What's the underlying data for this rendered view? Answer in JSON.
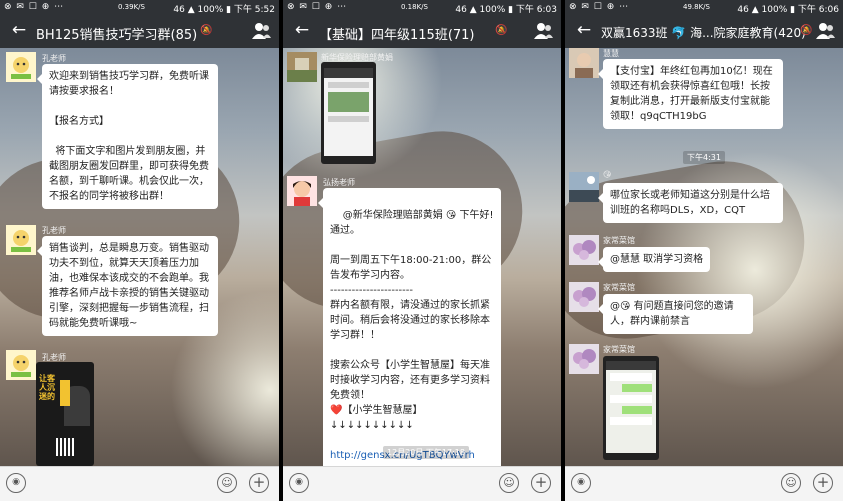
{
  "panels": [
    {
      "status": {
        "left_icons": "⊗ ✉ ☐ ⊕ ⋯",
        "speed": "0.39K/S",
        "right": "46 ▲ 100% ▮ 下午 5:52"
      },
      "header": {
        "title": "BH125销售技巧学习群(85)"
      },
      "messages": [
        {
          "nick": "孔老师",
          "text": "欢迎来到销售技巧学习群，免费听课请按要求报名！\n\n【报名方式】\n\n  将下面文字和图片发到朋友圈，并截图朋友圈发回群里，即可获得免费名额，到千聊听课。机会仅此一次，不报名的同学将被移出群！"
        },
        {
          "nick": "孔老师",
          "text": "销售谈判，总是瞬息万变。销售驱动功夫不到位，就算天天顶着压力加油，也难保本该成交的不会跑单。我推荐名师卢战卡亲授的销售关键驱动引擎，深刻把握每一步销售流程，扫码就能免费听课哦~"
        },
        {
          "nick": "孔老师",
          "poster_text": "让客人沉迷的"
        }
      ]
    },
    {
      "status": {
        "left_icons": "⊗ ✉ ☐ ⊕ ⋯",
        "speed": "0.18K/S",
        "right": "46 ▲ 100% ▮ 下午 6:03"
      },
      "header": {
        "title": "【基础】四年级115班(71)"
      },
      "messages": [
        {
          "nick": "新华保险理赔部黄娟"
        },
        {
          "nick": "弘扬老师",
          "text_main": "@新华保险理赔部黄娟 😘 下午好!通过。\n\n周一到周五下午18:00-21:00，群公告发布学习内容。\n-----------------------\n群内名额有限，请没通过的家长抓紧时间。稍后会将没通过的家长移除本学习群！！\n\n搜索公众号【小学生智慧屋】每天准时接收学习内容，还有更多学习资料免费领！\n❤️【小学生智慧屋】\n↓↓↓↓↓↓↓↓↓↓",
          "link": "http://gensx.cn/UgTBQYwVrh"
        }
      ],
      "timestamp": "12月20日 下午17:18"
    },
    {
      "status": {
        "left_icons": "⊗ ✉ ☐ ⊕ ⋯",
        "speed": "49.8K/S",
        "right": "46 ▲ 100% ▮ 下午 6:06"
      },
      "header": {
        "title": "双赢1633班 🐬 海...院家庭教育(420)"
      },
      "messages": [
        {
          "nick": "慧慧",
          "text": "【支付宝】年终红包再加10亿！现在领取还有机会获得惊喜红包哦！长按复制此消息，打开最新版支付宝就能领取！q9qCTH19bG"
        },
        {
          "nick": "",
          "text": "哪位家长或老师知道这分别是什么培训班的名称吗DLS，XD，CQT"
        },
        {
          "nick": "家常菜馆",
          "text": "@慧慧 取消学习资格"
        },
        {
          "nick": "家常菜馆",
          "text": "@😘 有问题直接问您的邀请人，群内课前禁言"
        },
        {
          "nick": "家常菜馆"
        }
      ],
      "timestamp": "下午4:31",
      "extra_emoji": "😘"
    }
  ],
  "bottombar": {
    "voice": "◉",
    "emoji": "☺",
    "plus": "+"
  },
  "colors": {
    "header": "#2f3236",
    "bubble": "#ffffff",
    "link": "#1a5fb4"
  }
}
